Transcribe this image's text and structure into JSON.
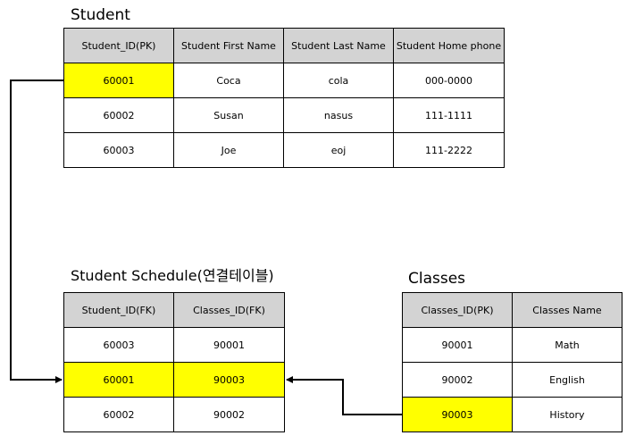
{
  "student": {
    "title": "Student",
    "headers": [
      "Student_ID(PK)",
      "Student First Name",
      "Student Last Name",
      "Student Home phone"
    ],
    "rows": [
      [
        "60001",
        "Coca",
        "cola",
        "000-0000"
      ],
      [
        "60002",
        "Susan",
        "nasus",
        "111-1111"
      ],
      [
        "60003",
        "Joe",
        "eoj",
        "111-2222"
      ]
    ]
  },
  "schedule": {
    "title": "Student Schedule(연결테이블)",
    "headers": [
      "Student_ID(FK)",
      "Classes_ID(FK)"
    ],
    "rows": [
      [
        "60003",
        "90001"
      ],
      [
        "60001",
        "90003"
      ],
      [
        "60002",
        "90002"
      ]
    ]
  },
  "classes": {
    "title": "Classes",
    "headers": [
      "Classes_ID(PK)",
      "Classes Name"
    ],
    "rows": [
      [
        "90001",
        "Math"
      ],
      [
        "90002",
        "English"
      ],
      [
        "90003",
        "History"
      ]
    ]
  },
  "colors": {
    "header_bg": "#d3d3d3",
    "highlight": "#ffff00",
    "border": "#000000"
  }
}
